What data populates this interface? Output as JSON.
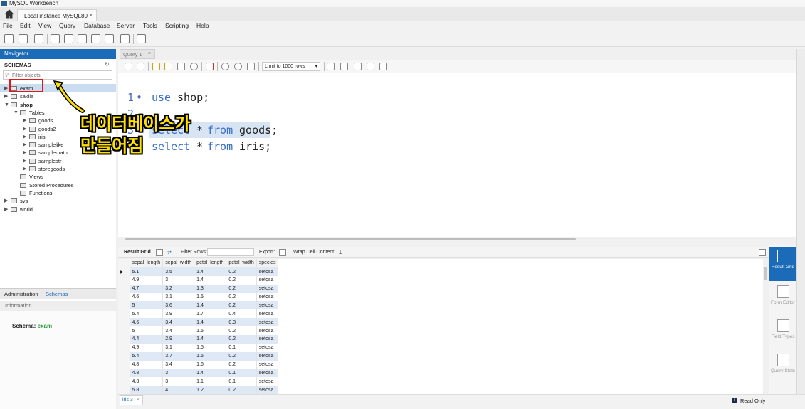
{
  "window": {
    "title": "MySQL Workbench"
  },
  "connection_tab": {
    "label": "Local instance MySQL80",
    "close": "×"
  },
  "menu": [
    "File",
    "Edit",
    "View",
    "Query",
    "Database",
    "Server",
    "Tools",
    "Scripting",
    "Help"
  ],
  "navigator": {
    "header": "Navigator",
    "schemas_label": "SCHEMAS",
    "filter_placeholder": "Filter objects",
    "tree": [
      {
        "label": "exam",
        "level": 0,
        "arrow": "▶",
        "selected": true
      },
      {
        "label": "sakila",
        "level": 0,
        "arrow": "▶"
      },
      {
        "label": "shop",
        "level": 0,
        "arrow": "▼",
        "bold": true
      },
      {
        "label": "Tables",
        "level": 1,
        "arrow": "▼"
      },
      {
        "label": "goods",
        "level": 2,
        "arrow": "▶"
      },
      {
        "label": "goods2",
        "level": 2,
        "arrow": "▶"
      },
      {
        "label": "iris",
        "level": 2,
        "arrow": "▶"
      },
      {
        "label": "samplelike",
        "level": 2,
        "arrow": "▶"
      },
      {
        "label": "samplemath",
        "level": 2,
        "arrow": "▶"
      },
      {
        "label": "samplestr",
        "level": 2,
        "arrow": "▶"
      },
      {
        "label": "storegoods",
        "level": 2,
        "arrow": "▶"
      },
      {
        "label": "Views",
        "level": 1,
        "arrow": ""
      },
      {
        "label": "Stored Procedures",
        "level": 1,
        "arrow": ""
      },
      {
        "label": "Functions",
        "level": 1,
        "arrow": ""
      },
      {
        "label": "sys",
        "level": 0,
        "arrow": "▶"
      },
      {
        "label": "world",
        "level": 0,
        "arrow": "▶"
      }
    ],
    "bottom_tabs": {
      "administration": "Administration",
      "schemas": "Schemas"
    },
    "info_header": "Information",
    "schema_info_label": "Schema:",
    "schema_info_value": "exam"
  },
  "query": {
    "tab_label": "Query 1",
    "tab_close": "×",
    "limit_label": "Limit to 1000 rows",
    "limit_caret": "▾",
    "lines": [
      {
        "num": "1",
        "dot": "•",
        "kw": "use",
        "rest": " shop;"
      },
      {
        "num": "2",
        "dot": "",
        "kw": "",
        "rest": ""
      },
      {
        "num": "3",
        "dot": "•",
        "kw": "select",
        "rest": " * ",
        "kw2": "from",
        "rest2": " goods;"
      },
      {
        "num": "4",
        "dot": "•",
        "kw": "select",
        "rest": " * ",
        "kw2": "from",
        "rest2": " iris;"
      }
    ]
  },
  "overlay": {
    "line1": "데이터베이스가",
    "line2": "만들어짐"
  },
  "result_toolbar": {
    "result_grid": "Result Grid",
    "filter_rows": "Filter Rows:",
    "export": "Export:",
    "wrap": "Wrap Cell Content:"
  },
  "grid": {
    "columns": [
      "sepal_length",
      "sepal_width",
      "petal_length",
      "petal_width",
      "species"
    ],
    "rows": [
      [
        "5.1",
        "3.5",
        "1.4",
        "0.2",
        "setosa"
      ],
      [
        "4.9",
        "3",
        "1.4",
        "0.2",
        "setosa"
      ],
      [
        "4.7",
        "3.2",
        "1.3",
        "0.2",
        "setosa"
      ],
      [
        "4.6",
        "3.1",
        "1.5",
        "0.2",
        "setosa"
      ],
      [
        "5",
        "3.6",
        "1.4",
        "0.2",
        "setosa"
      ],
      [
        "5.4",
        "3.9",
        "1.7",
        "0.4",
        "setosa"
      ],
      [
        "4.6",
        "3.4",
        "1.4",
        "0.3",
        "setosa"
      ],
      [
        "5",
        "3.4",
        "1.5",
        "0.2",
        "setosa"
      ],
      [
        "4.4",
        "2.9",
        "1.4",
        "0.2",
        "setosa"
      ],
      [
        "4.9",
        "3.1",
        "1.5",
        "0.1",
        "setosa"
      ],
      [
        "5.4",
        "3.7",
        "1.5",
        "0.2",
        "setosa"
      ],
      [
        "4.8",
        "3.4",
        "1.6",
        "0.2",
        "setosa"
      ],
      [
        "4.8",
        "3",
        "1.4",
        "0.1",
        "setosa"
      ],
      [
        "4.3",
        "3",
        "1.1",
        "0.1",
        "setosa"
      ],
      [
        "5.8",
        "4",
        "1.2",
        "0.2",
        "setosa"
      ]
    ]
  },
  "side_panel": [
    {
      "label": "Result Grid",
      "active": true
    },
    {
      "label": "Form Editor"
    },
    {
      "label": "Field Types"
    },
    {
      "label": "Query Stats"
    }
  ],
  "bottom": {
    "result_tab": "iris 3",
    "result_tab_close": "×",
    "status": "Read Only",
    "status_icon": "i"
  },
  "colors": {
    "accent": "#1c6bb8",
    "keyword": "#3a6fc8",
    "schema_green": "#2a9a3a",
    "overlay_yellow": "#ffe000",
    "highlight_red": "#e4161b"
  }
}
